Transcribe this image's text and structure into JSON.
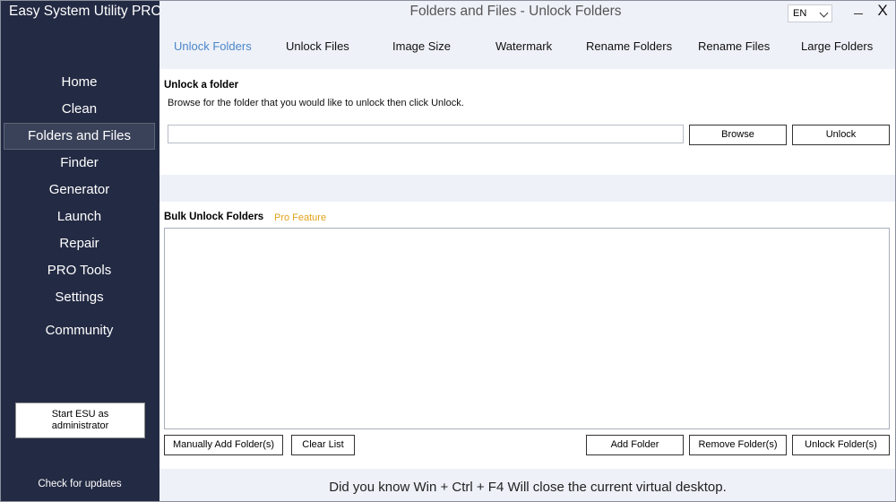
{
  "sidebar": {
    "app_title": "Easy System Utility PRO",
    "items": [
      {
        "label": "Home"
      },
      {
        "label": "Clean"
      },
      {
        "label": "Folders and Files"
      },
      {
        "label": "Finder"
      },
      {
        "label": "Generator"
      },
      {
        "label": "Launch"
      },
      {
        "label": "Repair"
      },
      {
        "label": "PRO Tools"
      },
      {
        "label": "Settings"
      },
      {
        "label": "Community"
      }
    ],
    "active_item": "Folders and Files",
    "admin_button": "Start ESU as administrator",
    "updates_link": "Check for updates"
  },
  "header": {
    "title": "Folders and Files - Unlock Folders",
    "language": "EN",
    "close_glyph": "X"
  },
  "tabs": [
    {
      "label": "Unlock Folders"
    },
    {
      "label": "Unlock Files"
    },
    {
      "label": "Image Size"
    },
    {
      "label": "Watermark"
    },
    {
      "label": "Rename Folders"
    },
    {
      "label": "Rename Files"
    },
    {
      "label": "Large Folders"
    }
  ],
  "active_tab": "Unlock Folders",
  "unlock_section": {
    "title": "Unlock a folder",
    "description": "Browse for the folder that you would like to unlock then click Unlock.",
    "path_value": "",
    "browse_label": "Browse",
    "unlock_label": "Unlock"
  },
  "bulk_section": {
    "title": "Bulk Unlock Folders",
    "pro_badge": "Pro Feature",
    "manual_add_label": "Manually Add Folder(s)",
    "clear_label": "Clear List",
    "add_label": "Add Folder",
    "remove_label": "Remove Folder(s)",
    "unlock_label": "Unlock Folder(s)"
  },
  "tip": "Did you know Win + Ctrl + F4 Will close the current virtual desktop.",
  "colors": {
    "sidebar_bg": "#232a43",
    "accent": "#4a86c8",
    "pro_badge": "#e2a21a",
    "main_bg": "#eef1f8"
  }
}
